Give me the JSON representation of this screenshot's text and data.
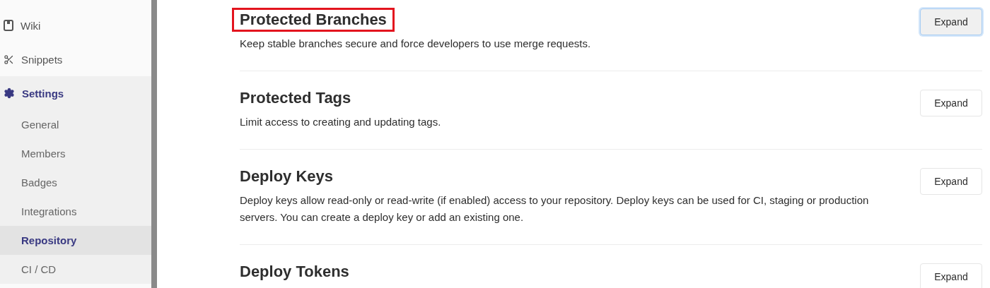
{
  "sidebar": {
    "items": [
      {
        "label": "Wiki",
        "active": false
      },
      {
        "label": "Snippets",
        "active": false
      },
      {
        "label": "Settings",
        "active": true,
        "children": [
          {
            "label": "General",
            "selected": false
          },
          {
            "label": "Members",
            "selected": false
          },
          {
            "label": "Badges",
            "selected": false
          },
          {
            "label": "Integrations",
            "selected": false
          },
          {
            "label": "Repository",
            "selected": true
          },
          {
            "label": "CI / CD",
            "selected": false
          }
        ]
      }
    ]
  },
  "sections": [
    {
      "title": "Protected Branches",
      "highlighted": true,
      "description": "Keep stable branches secure and force developers to use merge requests.",
      "button": {
        "label": "Expand",
        "focused": true
      }
    },
    {
      "title": "Protected Tags",
      "highlighted": false,
      "description": "Limit access to creating and updating tags.",
      "button": {
        "label": "Expand",
        "focused": false
      }
    },
    {
      "title": "Deploy Keys",
      "highlighted": false,
      "description": "Deploy keys allow read-only or read-write (if enabled) access to your repository. Deploy keys can be used for CI, staging or production servers. You can create a deploy key or add an existing one.",
      "button": {
        "label": "Expand",
        "focused": false
      }
    },
    {
      "title": "Deploy Tokens",
      "highlighted": false,
      "button": {
        "label": "Expand",
        "focused": false
      }
    }
  ]
}
